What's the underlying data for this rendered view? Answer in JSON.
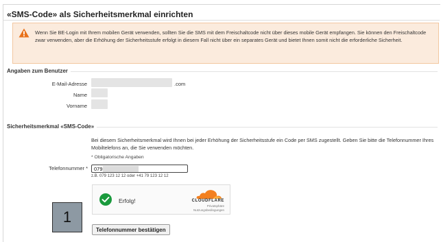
{
  "page": {
    "title": "«SMS-Code» als Sicherheitsmerkmal einrichten"
  },
  "warning": {
    "icon": "warning-triangle-icon",
    "color": "#e8711a",
    "text": "Wenn Sie BE-Login mit Ihrem mobilen Gerät verwenden, sollten Sie die SMS mit dem Freischaltcode nicht über dieses mobile Gerät empfangen. Sie können den Freischaltcode zwar verwenden, aber die Erhöhung der Sicherheitsstufe erfolgt in diesem Fall nicht über ein separates Gerät und bietet Ihnen somit nicht die erforderliche Sicherheit."
  },
  "user_section": {
    "legend": "Angaben zum Benutzer",
    "email_label": "E-Mail-Adresse",
    "email_value_suffix": ".com",
    "name_label": "Name",
    "firstname_label": "Vorname"
  },
  "security_section": {
    "legend": "Sicherheitsmerkmal «SMS-Code»",
    "description": "Bei diesem Sicherheitsmerkmal wird Ihnen bei jeder Erhöhung der Sicherheitsstufe ein Code per SMS zugestellt. Geben Sie bitte die Telefonnummer Ihres Mobiltelefons an, die Sie verwenden möchten.",
    "mandatory_note": "* Obligatorische Angaben",
    "phone_label": "Telefonnummer *",
    "phone_value": "079",
    "phone_example": "z.B. 079 123 12 12 oder +41 79 123 12 12"
  },
  "captcha": {
    "status": "Erfolg!",
    "brand": "CLOUDFLARE",
    "privacy": "Privatsphäre",
    "terms": "Nutzungsbedingungen",
    "success_color": "#1a9a3d",
    "brand_color": "#f38020"
  },
  "confirm_button": {
    "label": "Telefonnummer bestätigen"
  },
  "annotation": {
    "label": "1"
  }
}
